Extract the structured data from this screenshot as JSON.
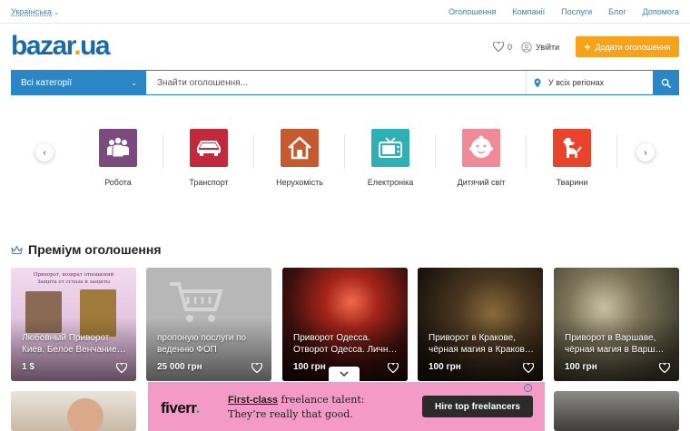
{
  "topbar": {
    "language": "Українська",
    "nav": [
      "Оголошення",
      "Компанії",
      "Послуги",
      "Блог",
      "Допомога"
    ]
  },
  "header": {
    "logo_main": "bazar",
    "logo_dot": ".",
    "logo_tld": "ua",
    "favorites_count": "0",
    "login_label": "Увійти",
    "add_button_label": "Додати оголошення"
  },
  "search": {
    "category_label": "Всі категорії",
    "placeholder": "Знайти оголошення...",
    "region_label": "У всіх регіонах"
  },
  "categories": [
    {
      "label": "Робота",
      "color": "#7a4b7e",
      "icon": "workers-icon"
    },
    {
      "label": "Транспорт",
      "color": "#c02a3a",
      "icon": "car-icon"
    },
    {
      "label": "Нерухомість",
      "color": "#c65a2e",
      "icon": "house-icon"
    },
    {
      "label": "Електроніка",
      "color": "#2fb0b5",
      "icon": "tv-icon"
    },
    {
      "label": "Дитячий світ",
      "color": "#f08a99",
      "icon": "baby-icon"
    },
    {
      "label": "Тварини",
      "color": "#e8442c",
      "icon": "dog-icon"
    }
  ],
  "premium": {
    "title": "Преміум оголошення",
    "cards": [
      {
        "title": "Любовный Приворот Киев. Белое Венчание…",
        "price": "1 $"
      },
      {
        "title": "пропоную послуги по веденню ФОП",
        "price": "25 000 грн"
      },
      {
        "title": "Приворот Одесса. Отворот Одесса. Личн…",
        "price": "100 грн"
      },
      {
        "title": "Приворот в Кракове, чёрная магия в Краков…",
        "price": "100 грн"
      },
      {
        "title": "Приворот в Варшаве, чёрная магия в Варш…",
        "price": "100 грн"
      }
    ],
    "card1_overlay_text": [
      "Приворот, возврат отношений",
      "Защита от сглаза и защиты"
    ]
  },
  "ad": {
    "brand": "fiverr",
    "brand_dot": ".",
    "headline_emphasis": "First-class",
    "headline_rest": " freelance talent:",
    "subline": "They’re really that good.",
    "cta": "Hire top freelancers",
    "info": "i"
  },
  "colors": {
    "brand_blue": "#2a86c5",
    "accent_orange": "#f7a21b",
    "logo_blue": "#1a6aa8",
    "ad_pink": "#f39ac6"
  }
}
